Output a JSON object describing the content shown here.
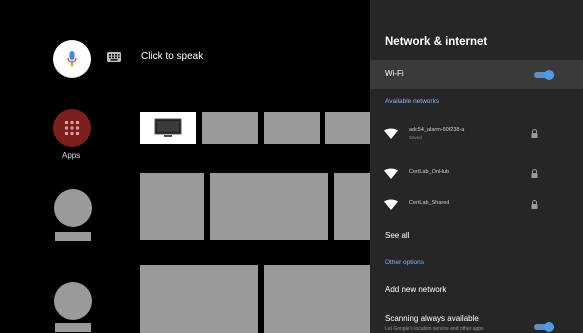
{
  "launcher": {
    "search": {
      "icon": "mic-icon",
      "label": "Click to speak",
      "keyboard_icon": "keyboard-icon"
    },
    "apps": {
      "label": "Apps",
      "icon": "grid-icon"
    }
  },
  "settings_panel": {
    "title": "Network & internet",
    "wifi": {
      "label": "Wi-Fi",
      "enabled": true
    },
    "available_networks_header": "Available networks",
    "networks": [
      {
        "name": "adc54_alarm-60f238-a",
        "status": "Saved",
        "secured": true
      },
      {
        "name": "CertLab_OnHub",
        "status": "",
        "secured": true
      },
      {
        "name": "CertLab_Shared",
        "status": "",
        "secured": true
      }
    ],
    "see_all": "See all",
    "other_options_header": "Other options",
    "add_network": "Add new network",
    "scanning": {
      "label": "Scanning always available",
      "description": "Let Google's location service and other apps",
      "enabled": true
    }
  },
  "colors": {
    "accent": "#4d9be8",
    "section_header": "#8ab4f8",
    "panel_bg": "#262626",
    "apps_bg": "#7c1f1f"
  }
}
